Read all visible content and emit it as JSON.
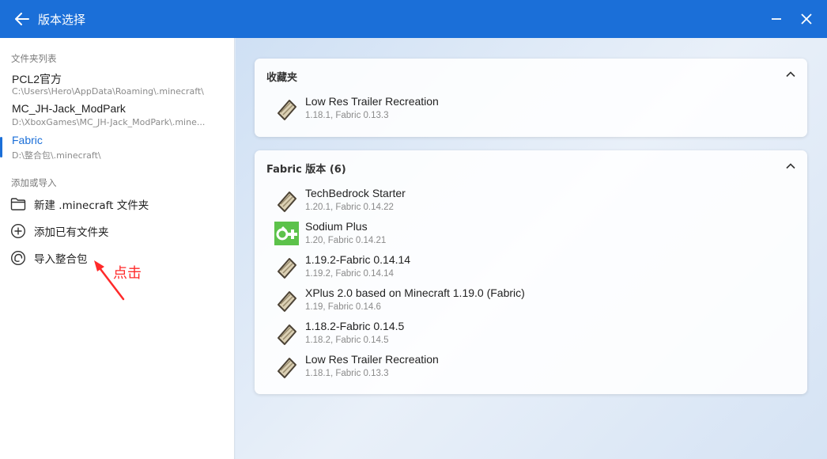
{
  "titlebar": {
    "title": "版本选择"
  },
  "sidebar": {
    "folders_label": "文件夹列表",
    "folders": [
      {
        "name": "PCL2官方",
        "path": "C:\\Users\\Hero\\AppData\\Roaming\\.minecraft\\"
      },
      {
        "name": "MC_JH-Jack_ModPark",
        "path": "D:\\XboxGames\\MC_JH-Jack_ModPark\\.mine..."
      },
      {
        "name": "Fabric",
        "path": "D:\\整合包\\.minecraft\\"
      }
    ],
    "actions_label": "添加或导入",
    "actions": [
      {
        "label": "新建 .minecraft 文件夹",
        "icon": "folder-icon"
      },
      {
        "label": "添加已有文件夹",
        "icon": "plus-circle-icon"
      },
      {
        "label": "导入整合包",
        "icon": "import-package-icon"
      }
    ],
    "annotation": "点击"
  },
  "favorites": {
    "header": "收藏夹",
    "items": [
      {
        "name": "Low Res Trailer Recreation",
        "sub": "1.18.1, Fabric 0.13.3",
        "icon": "fabric-icon"
      }
    ]
  },
  "fabric": {
    "header": "Fabric 版本 (6)",
    "items": [
      {
        "name": "TechBedrock Starter",
        "sub": "1.20.1, Fabric 0.14.22",
        "icon": "fabric-icon"
      },
      {
        "name": "Sodium Plus",
        "sub": "1.20, Fabric 0.14.21",
        "icon": "sodium-icon"
      },
      {
        "name": "1.19.2-Fabric 0.14.14",
        "sub": "1.19.2, Fabric 0.14.14",
        "icon": "fabric-icon"
      },
      {
        "name": "XPlus 2.0 based on Minecraft 1.19.0 (Fabric)",
        "sub": "1.19, Fabric 0.14.6",
        "icon": "fabric-icon"
      },
      {
        "name": "1.18.2-Fabric 0.14.5",
        "sub": "1.18.2, Fabric 0.14.5",
        "icon": "fabric-icon"
      },
      {
        "name": "Low Res Trailer Recreation",
        "sub": "1.18.1, Fabric 0.13.3",
        "icon": "fabric-icon"
      }
    ]
  },
  "colors": {
    "accent": "#1b6fd8",
    "annotation": "#ff2a2a",
    "sodium": "#5cc24a"
  }
}
